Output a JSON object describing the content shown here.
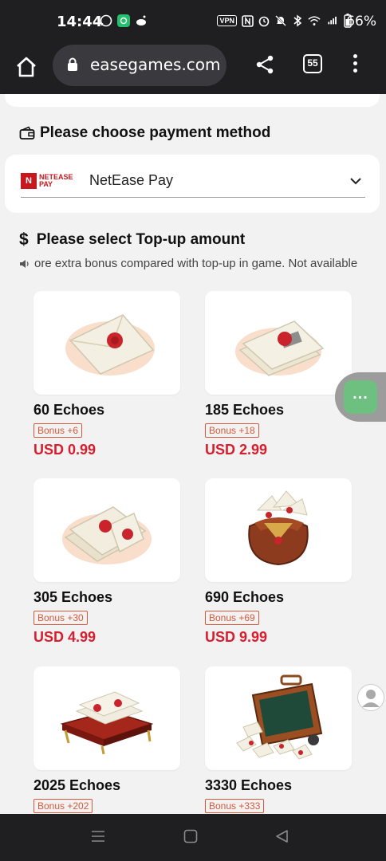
{
  "status_bar": {
    "time": "14:44",
    "vpn": "VPN",
    "battery": "66%"
  },
  "browser": {
    "url": "easegames.com",
    "tab_count": "55"
  },
  "payment": {
    "title": "Please choose payment method",
    "logo_mark": "N",
    "logo_text_line1": "NETEASE",
    "logo_text_line2": "PAY",
    "selected": "NetEase Pay"
  },
  "topup": {
    "title": "Please select Top-up amount",
    "notice": "ore extra bonus compared with top-up in game. Not available",
    "products": [
      {
        "name": "60 Echoes",
        "bonus": "Bonus +6",
        "price": "USD 0.99"
      },
      {
        "name": "185 Echoes",
        "bonus": "Bonus +18",
        "price": "USD 2.99"
      },
      {
        "name": "305 Echoes",
        "bonus": "Bonus +30",
        "price": "USD 4.99"
      },
      {
        "name": "690 Echoes",
        "bonus": "Bonus +69",
        "price": "USD 9.99"
      },
      {
        "name": "2025 Echoes",
        "bonus": "Bonus +202",
        "price": ""
      },
      {
        "name": "3330 Echoes",
        "bonus": "Bonus +333",
        "price": ""
      }
    ]
  },
  "colors": {
    "accent_red": "#d81e2e",
    "bonus_orange": "#d4593b",
    "float_green": "#6ec081",
    "dark_bar": "#1f1f21"
  }
}
